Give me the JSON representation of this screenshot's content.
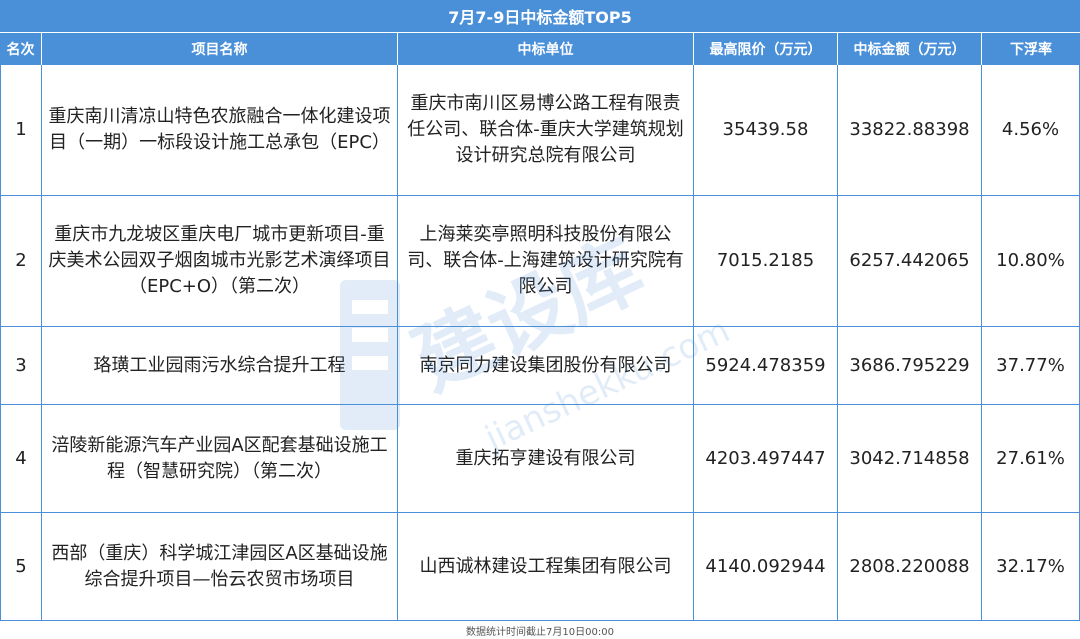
{
  "title": "7月7-9日中标金额TOP5",
  "columns": [
    "名次",
    "项目名称",
    "中标单位",
    "最高限价（万元）",
    "中标金额（万元）",
    "下浮率"
  ],
  "rows": [
    {
      "rank": "1",
      "project": "重庆南川清凉山特色农旅融合一体化建设项目（一期）一标段设计施工总承包（EPC）",
      "winner": "重庆市南川区易博公路工程有限责任公司、联合体-重庆大学建筑规划设计研究总院有限公司",
      "max_price": "35439.58",
      "amount": "33822.88398",
      "rate": "4.56%"
    },
    {
      "rank": "2",
      "project": "重庆市九龙坡区重庆电厂城市更新项目-重庆美术公园双子烟囱城市光影艺术演绎项目（EPC+O）（第二次）",
      "winner": "上海莱奕亭照明科技股份有限公司、联合体-上海建筑设计研究院有限公司",
      "max_price": "7015.2185",
      "amount": "6257.442065",
      "rate": "10.80%"
    },
    {
      "rank": "3",
      "project": "珞璜工业园雨污水综合提升工程",
      "winner": "南京同力建设集团股份有限公司",
      "max_price": "5924.478359",
      "amount": "3686.795229",
      "rate": "37.77%"
    },
    {
      "rank": "4",
      "project": "涪陵新能源汽车产业园A区配套基础设施工程（智慧研究院）（第二次）",
      "winner": "重庆拓亨建设有限公司",
      "max_price": "4203.497447",
      "amount": "3042.714858",
      "rate": "27.61%"
    },
    {
      "rank": "5",
      "project": "西部（重庆）科学城江津园区A区基础设施综合提升项目—怡云农贸市场项目",
      "winner": "山西诚林建设工程集团有限公司",
      "max_price": "4140.092944",
      "amount": "2808.220088",
      "rate": "32.17%"
    }
  ],
  "footer": "数据统计时间截止7月10日00:00",
  "watermark": {
    "text": "建设库",
    "url": "jianshekku.com",
    "icon": "building-logo-icon"
  },
  "colors": {
    "header": "#4a90d9",
    "border": "#4a90d9",
    "text": "#222222"
  }
}
